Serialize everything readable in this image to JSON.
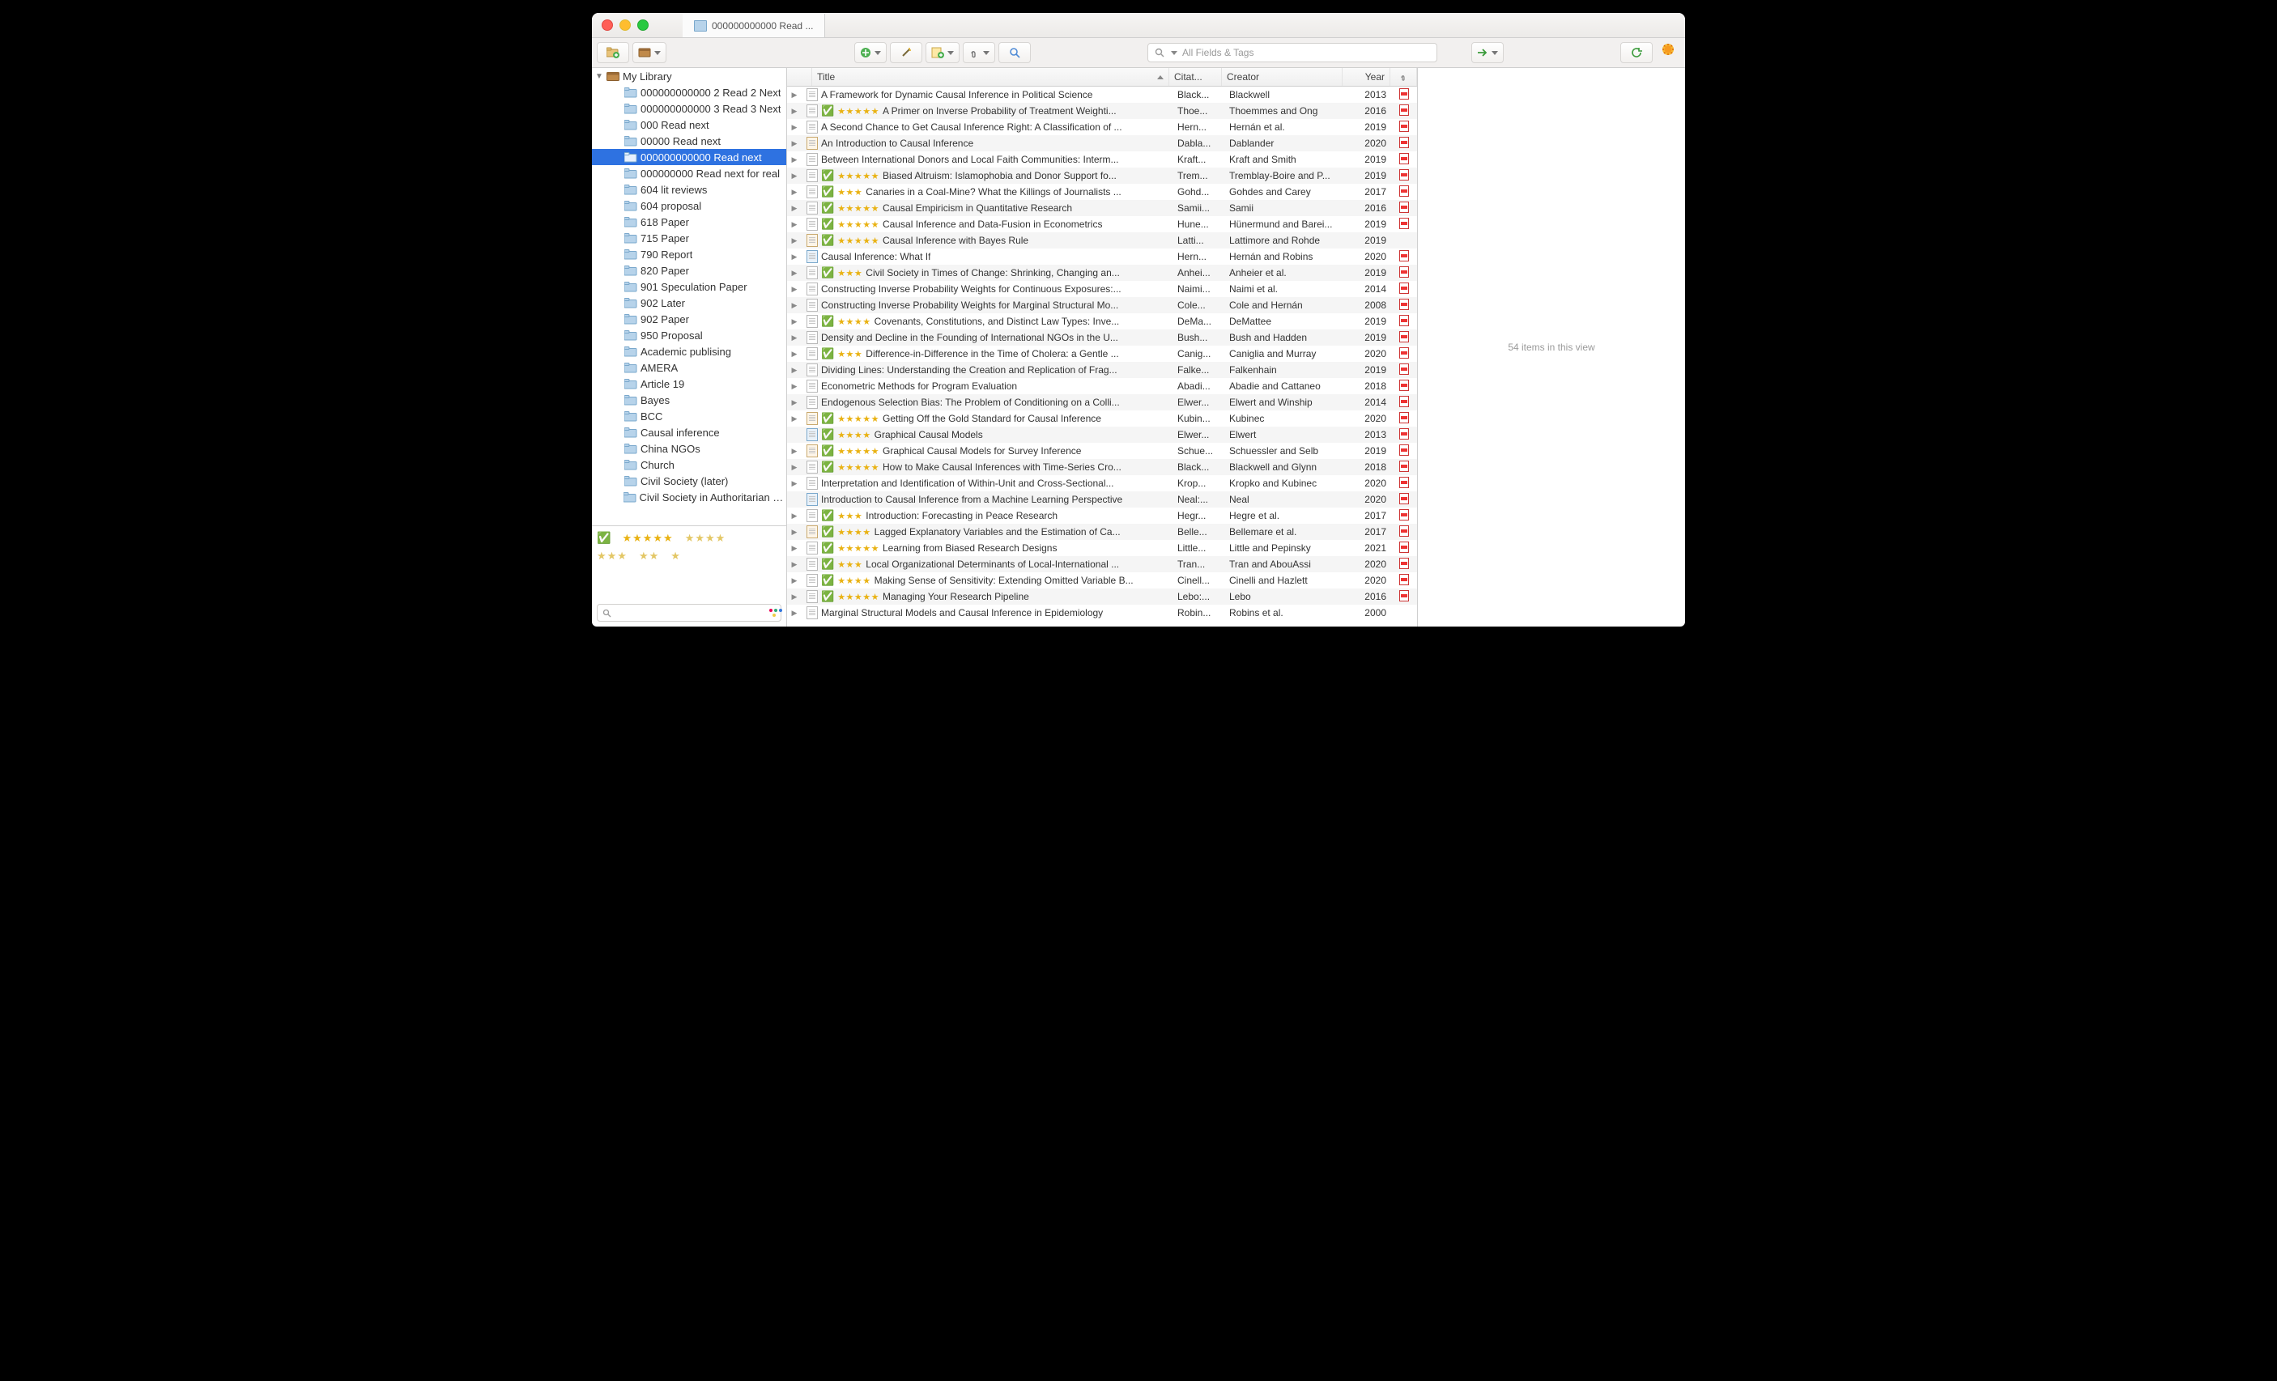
{
  "window": {
    "tab_label": "000000000000 Read ...",
    "traffic_close": "Close",
    "traffic_min": "Minimize",
    "traffic_max": "Maximize"
  },
  "toolbar": {
    "new_collection_tip": "New Collection",
    "new_library_tip": "New Library",
    "new_item_tip": "New Item",
    "wand_tip": "Add by Identifier",
    "new_note_tip": "New Note",
    "attach_tip": "Add Attachment",
    "lookup_tip": "Advanced Search",
    "locate_tip": "Locate",
    "sync_tip": "Sync",
    "error_tip": "Sync Error"
  },
  "search": {
    "placeholder": "All Fields & Tags"
  },
  "library": {
    "root": "My Library",
    "folders": [
      "000000000000 2 Read 2 Next",
      "000000000000 3 Read 3 Next",
      "000 Read next",
      "00000 Read next",
      "000000000000 Read next",
      "000000000 Read next for real",
      "604 lit reviews",
      "604 proposal",
      "618 Paper",
      "715 Paper",
      "790 Report",
      "820 Paper",
      "901 Speculation Paper",
      "902 Later",
      "902 Paper",
      "950 Proposal",
      "Academic publising",
      "AMERA",
      "Article 19",
      "Bayes",
      "BCC",
      "Causal inference",
      "China NGOs",
      "Church",
      "Civil Society (later)",
      "Civil Society in Authoritarian Re..."
    ],
    "selected_index": 4
  },
  "tagpane": {
    "search_placeholder": ""
  },
  "columns": {
    "title": "Title",
    "citation": "Citat...",
    "creator": "Creator",
    "year": "Year"
  },
  "items": [
    {
      "expand": true,
      "type": "doc",
      "check": false,
      "stars": 0,
      "title": "A Framework for Dynamic Causal Inference in Political Science",
      "cite": "Black...",
      "creator": "Blackwell",
      "year": "2013",
      "pdf": true
    },
    {
      "expand": true,
      "type": "doc",
      "check": true,
      "stars": 5,
      "title": "A Primer on Inverse Probability of Treatment Weighti...",
      "cite": "Thoe...",
      "creator": "Thoemmes and Ong",
      "year": "2016",
      "pdf": true
    },
    {
      "expand": true,
      "type": "doc",
      "check": false,
      "stars": 0,
      "title": "A Second Chance to Get Causal Inference Right: A Classification of ...",
      "cite": "Hern...",
      "creator": "Hernán et al.",
      "year": "2019",
      "pdf": true
    },
    {
      "expand": true,
      "type": "web",
      "check": false,
      "stars": 0,
      "title": "An Introduction to Causal Inference",
      "cite": "Dabla...",
      "creator": "Dablander",
      "year": "2020",
      "pdf": true
    },
    {
      "expand": true,
      "type": "doc",
      "check": false,
      "stars": 0,
      "title": "Between International Donors and Local Faith Communities: Interm...",
      "cite": "Kraft...",
      "creator": "Kraft and Smith",
      "year": "2019",
      "pdf": true
    },
    {
      "expand": true,
      "type": "doc",
      "check": true,
      "stars": 5,
      "title": "Biased Altruism: Islamophobia and Donor Support fo...",
      "cite": "Trem...",
      "creator": "Tremblay-Boire and P...",
      "year": "2019",
      "pdf": true
    },
    {
      "expand": true,
      "type": "doc",
      "check": true,
      "stars": 3,
      "title": "Canaries in a Coal-Mine? What the Killings of Journalists ...",
      "cite": "Gohd...",
      "creator": "Gohdes and Carey",
      "year": "2017",
      "pdf": true
    },
    {
      "expand": true,
      "type": "doc",
      "check": true,
      "stars": 5,
      "title": "Causal Empiricism in Quantitative Research",
      "cite": "Samii...",
      "creator": "Samii",
      "year": "2016",
      "pdf": true
    },
    {
      "expand": true,
      "type": "doc",
      "check": true,
      "stars": 5,
      "title": "Causal Inference and Data-Fusion in Econometrics",
      "cite": "Hune...",
      "creator": "Hünermund and Barei...",
      "year": "2019",
      "pdf": true
    },
    {
      "expand": true,
      "type": "web",
      "check": true,
      "stars": 5,
      "title": "Causal Inference with Bayes Rule",
      "cite": "Latti...",
      "creator": "Lattimore and Rohde",
      "year": "2019",
      "pdf": false
    },
    {
      "expand": true,
      "type": "book",
      "check": false,
      "stars": 0,
      "title": "Causal Inference: What If",
      "cite": "Hern...",
      "creator": "Hernán and Robins",
      "year": "2020",
      "pdf": true
    },
    {
      "expand": true,
      "type": "doc",
      "check": true,
      "stars": 3,
      "title": "Civil Society in Times of Change: Shrinking, Changing an...",
      "cite": "Anhei...",
      "creator": "Anheier et al.",
      "year": "2019",
      "pdf": true
    },
    {
      "expand": true,
      "type": "doc",
      "check": false,
      "stars": 0,
      "title": "Constructing Inverse Probability Weights for Continuous Exposures:...",
      "cite": "Naimi...",
      "creator": "Naimi et al.",
      "year": "2014",
      "pdf": true
    },
    {
      "expand": true,
      "type": "doc",
      "check": false,
      "stars": 0,
      "title": "Constructing Inverse Probability Weights for Marginal Structural Mo...",
      "cite": "Cole...",
      "creator": "Cole and Hernán",
      "year": "2008",
      "pdf": true
    },
    {
      "expand": true,
      "type": "doc",
      "check": true,
      "stars": 4,
      "title": "Covenants, Constitutions, and Distinct Law Types: Inve...",
      "cite": "DeMa...",
      "creator": "DeMattee",
      "year": "2019",
      "pdf": true
    },
    {
      "expand": true,
      "type": "doc",
      "check": false,
      "stars": 0,
      "title": "Density and Decline in the Founding of International NGOs in the U...",
      "cite": "Bush...",
      "creator": "Bush and Hadden",
      "year": "2019",
      "pdf": true
    },
    {
      "expand": true,
      "type": "doc",
      "check": true,
      "stars": 3,
      "title": "Difference-in-Difference in the Time of Cholera: a Gentle ...",
      "cite": "Canig...",
      "creator": "Caniglia and Murray",
      "year": "2020",
      "pdf": true
    },
    {
      "expand": true,
      "type": "doc",
      "check": false,
      "stars": 0,
      "title": "Dividing Lines: Understanding the Creation and Replication of Frag...",
      "cite": "Falke...",
      "creator": "Falkenhain",
      "year": "2019",
      "pdf": true
    },
    {
      "expand": true,
      "type": "doc",
      "check": false,
      "stars": 0,
      "title": "Econometric Methods for Program Evaluation",
      "cite": "Abadi...",
      "creator": "Abadie and Cattaneo",
      "year": "2018",
      "pdf": true
    },
    {
      "expand": true,
      "type": "doc",
      "check": false,
      "stars": 0,
      "title": "Endogenous Selection Bias: The Problem of Conditioning on a Colli...",
      "cite": "Elwer...",
      "creator": "Elwert and Winship",
      "year": "2014",
      "pdf": true
    },
    {
      "expand": true,
      "type": "web",
      "check": true,
      "stars": 5,
      "title": "Getting Off the Gold Standard for Causal Inference",
      "cite": "Kubin...",
      "creator": "Kubinec",
      "year": "2020",
      "pdf": true
    },
    {
      "expand": false,
      "type": "book",
      "check": true,
      "stars": 4,
      "title": "Graphical Causal Models",
      "cite": "Elwer...",
      "creator": "Elwert",
      "year": "2013",
      "pdf": true
    },
    {
      "expand": true,
      "type": "web",
      "check": true,
      "stars": 5,
      "title": "Graphical Causal Models for Survey Inference",
      "cite": "Schue...",
      "creator": "Schuessler and Selb",
      "year": "2019",
      "pdf": true
    },
    {
      "expand": true,
      "type": "doc",
      "check": true,
      "stars": 5,
      "title": "How to Make Causal Inferences with Time-Series Cro...",
      "cite": "Black...",
      "creator": "Blackwell and Glynn",
      "year": "2018",
      "pdf": true
    },
    {
      "expand": true,
      "type": "doc",
      "check": false,
      "stars": 0,
      "title": "Interpretation and Identification of Within-Unit and Cross-Sectional...",
      "cite": "Krop...",
      "creator": "Kropko and Kubinec",
      "year": "2020",
      "pdf": true
    },
    {
      "expand": false,
      "type": "book",
      "check": false,
      "stars": 0,
      "title": "Introduction to Causal Inference from a Machine Learning Perspective",
      "cite": "Neal:...",
      "creator": "Neal",
      "year": "2020",
      "pdf": true
    },
    {
      "expand": true,
      "type": "doc",
      "check": true,
      "stars": 3,
      "title": "Introduction: Forecasting in Peace Research",
      "cite": "Hegr...",
      "creator": "Hegre et al.",
      "year": "2017",
      "pdf": true
    },
    {
      "expand": true,
      "type": "web",
      "check": true,
      "stars": 4,
      "title": "Lagged Explanatory Variables and the Estimation of Ca...",
      "cite": "Belle...",
      "creator": "Bellemare et al.",
      "year": "2017",
      "pdf": true
    },
    {
      "expand": true,
      "type": "doc",
      "check": true,
      "stars": 5,
      "title": "Learning from Biased Research Designs",
      "cite": "Little...",
      "creator": "Little and Pepinsky",
      "year": "2021",
      "pdf": true
    },
    {
      "expand": true,
      "type": "doc",
      "check": true,
      "stars": 3,
      "title": "Local Organizational Determinants of Local-International ...",
      "cite": "Tran...",
      "creator": "Tran and AbouAssi",
      "year": "2020",
      "pdf": true
    },
    {
      "expand": true,
      "type": "doc",
      "check": true,
      "stars": 4,
      "title": "Making Sense of Sensitivity: Extending Omitted Variable B...",
      "cite": "Cinell...",
      "creator": "Cinelli and Hazlett",
      "year": "2020",
      "pdf": true
    },
    {
      "expand": true,
      "type": "doc",
      "check": true,
      "stars": 5,
      "title": "Managing Your Research Pipeline",
      "cite": "Lebo:...",
      "creator": "Lebo",
      "year": "2016",
      "pdf": true
    },
    {
      "expand": true,
      "type": "doc",
      "check": false,
      "stars": 0,
      "title": "Marginal Structural Models and Causal Inference in Epidemiology",
      "cite": "Robin...",
      "creator": "Robins et al.",
      "year": "2000",
      "pdf": false
    }
  ],
  "rightpane": {
    "summary": "54 items in this view"
  }
}
